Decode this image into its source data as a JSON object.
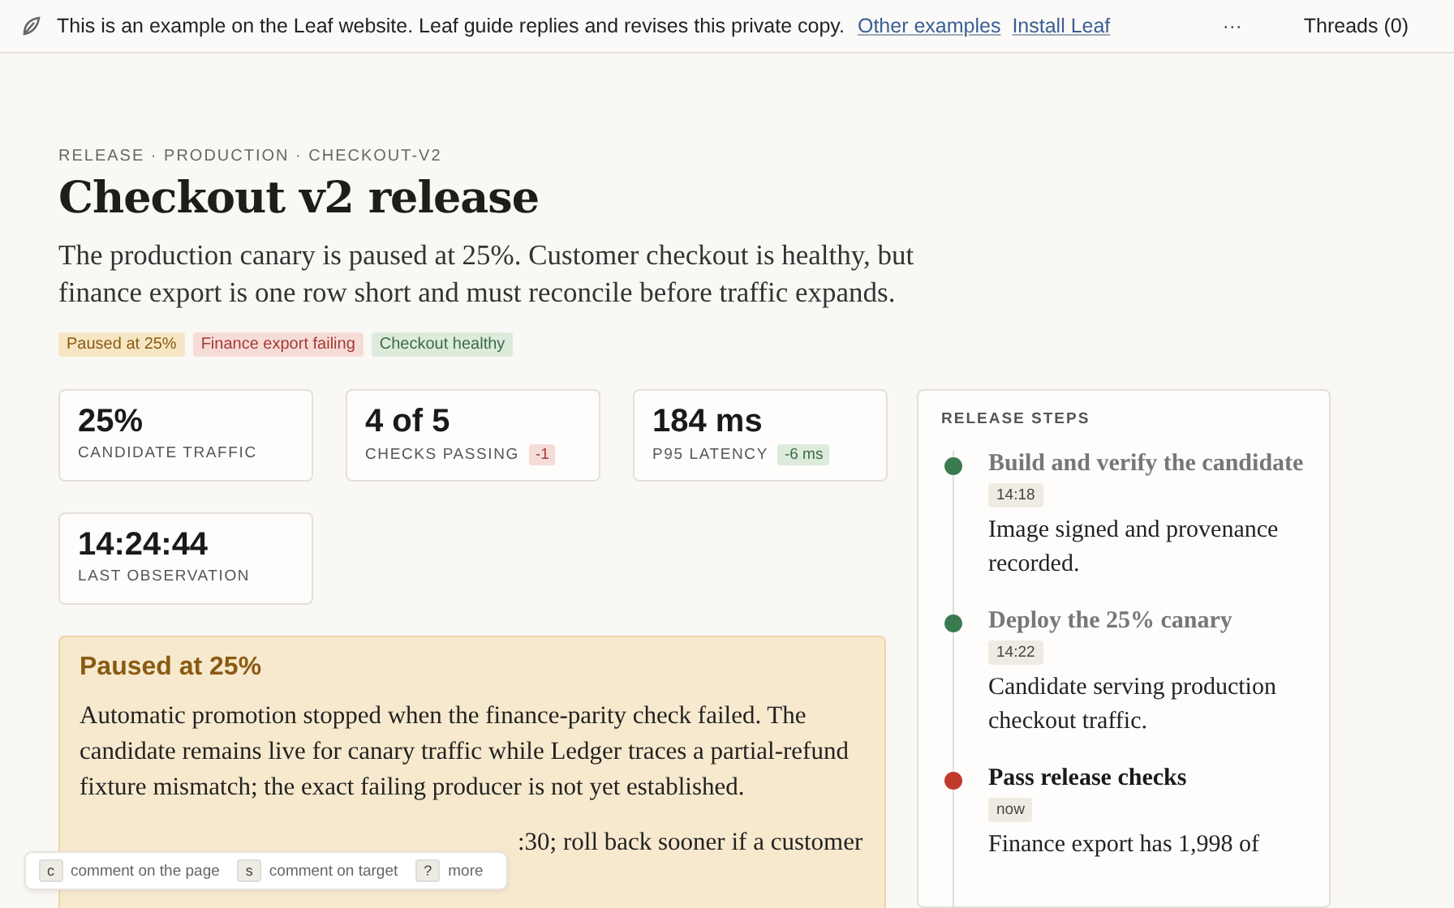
{
  "banner": {
    "message": "This is an example on the Leaf website. Leaf guide replies and revises this private copy.",
    "links": [
      "Other examples",
      "Install Leaf"
    ],
    "more": "···",
    "threads": "Threads (0)"
  },
  "breadcrumb": "RELEASE · PRODUCTION · CHECKOUT-V2",
  "title": "Checkout v2 release",
  "summary": "The production canary is paused at 25%. Customer checkout is healthy, but finance export is one row short and must reconcile before traffic expands.",
  "tags": [
    {
      "label": "Paused at 25%",
      "kind": "warn"
    },
    {
      "label": "Finance export failing",
      "kind": "fail"
    },
    {
      "label": "Checkout healthy",
      "kind": "ok"
    }
  ],
  "stats": [
    {
      "value": "25%",
      "label": "CANDIDATE TRAFFIC"
    },
    {
      "value": "4 of 5",
      "label": "CHECKS PASSING",
      "delta": {
        "text": "-1",
        "kind": "bad"
      }
    },
    {
      "value": "184 ms",
      "label": "P95 LATENCY",
      "delta": {
        "text": "-6 ms",
        "kind": "good"
      }
    },
    {
      "value": "14:24:44",
      "label": "LAST OBSERVATION"
    }
  ],
  "notice": {
    "title": "Paused at 25%",
    "paragraphs": [
      "Automatic promotion stopped when the finance-parity check failed. The candidate remains live for canary traffic while Ledger traces a partial-refund fixture mismatch; the exact failing producer is not yet established.",
      ":30; roll back sooner if a customer"
    ]
  },
  "steps_panel": {
    "heading": "RELEASE STEPS",
    "steps": [
      {
        "title": "Build and verify the candidate",
        "time": "14:18",
        "text": "Image signed and provenance recorded.",
        "done": true,
        "color": "#3a7a4f"
      },
      {
        "title": "Deploy the 25% canary",
        "time": "14:22",
        "text": "Candidate serving production checkout traffic.",
        "done": true,
        "color": "#3a7a4f"
      },
      {
        "title": "Pass release checks",
        "time": "now",
        "text": "Finance export has 1,998 of",
        "done": false,
        "color": "#c0392b"
      }
    ]
  },
  "shortcuts": [
    {
      "key": "c",
      "label": "comment on the page"
    },
    {
      "key": "s",
      "label": "comment on target"
    },
    {
      "key": "?",
      "label": "more"
    }
  ]
}
